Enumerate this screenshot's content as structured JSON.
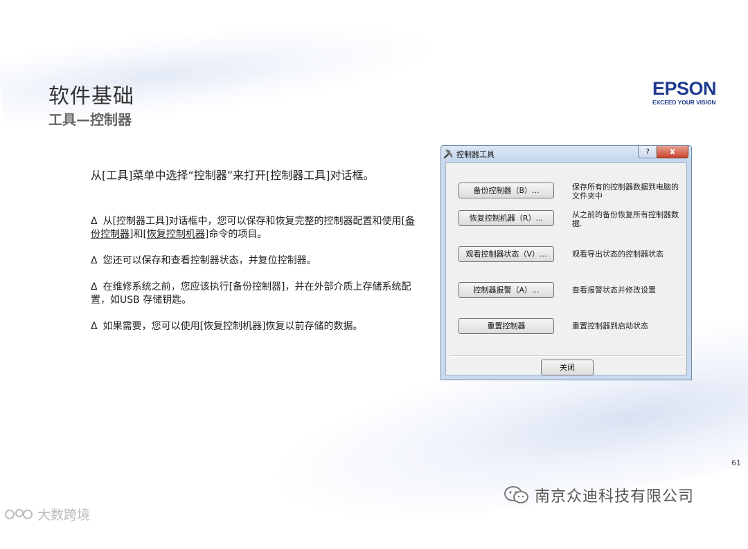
{
  "slide": {
    "title": "软件基础",
    "subtitle": "工具—控制器",
    "page_number": "61"
  },
  "logo": {
    "word": "EPSON",
    "tagline": "EXCEED YOUR VISION",
    "color": "#1f3b8f"
  },
  "intro": "从[工具]菜单中选择“控制器”来打开[控制器工具]对话框。",
  "bullets": [
    {
      "marker": "Δ",
      "text_a": "从[控制器工具]对话框中，您可以保存和恢复完整的控制器配置和使用",
      "link_1": "[备份控制器]",
      "mid": "和",
      "link_2": "[恢复控制机器]",
      "text_b": "命令的项目。"
    },
    {
      "marker": "Δ",
      "text": "您还可以保存和查看控制器状态，并复位控制器。"
    },
    {
      "marker": "Δ",
      "text": "在维修系统之前，您应该执行[备份控制器]，并在外部介质上存储系统配置，如USB 存储钥匙。"
    },
    {
      "marker": "Δ",
      "text": "如果需要，您可以使用[恢复控制机器]恢复以前存储的数据。"
    }
  ],
  "dialog": {
    "title": "控制器工具",
    "title_icon": "tools-icon",
    "help_label": "?",
    "close_glyph": "x",
    "actions": [
      {
        "label": "备份控制器（B）...",
        "description": "保存所有的控制器数据到电脑的文件夹中"
      },
      {
        "label": "恢复控制机器（R）...",
        "description": "从之前的备份恢复所有控制器数据."
      },
      {
        "label": "观看控制器状态（V）...",
        "description": "观看导出状态的控制器状态"
      },
      {
        "label": "控制器报警（A）...",
        "description": "查看报警状态并修改设置"
      },
      {
        "label": "重置控制器",
        "description": "重置控制器到启动状态"
      }
    ],
    "close_button": "关闭"
  },
  "footer": {
    "wechat_account": "南京众迪科技有限公司",
    "watermark": "大数跨境"
  }
}
